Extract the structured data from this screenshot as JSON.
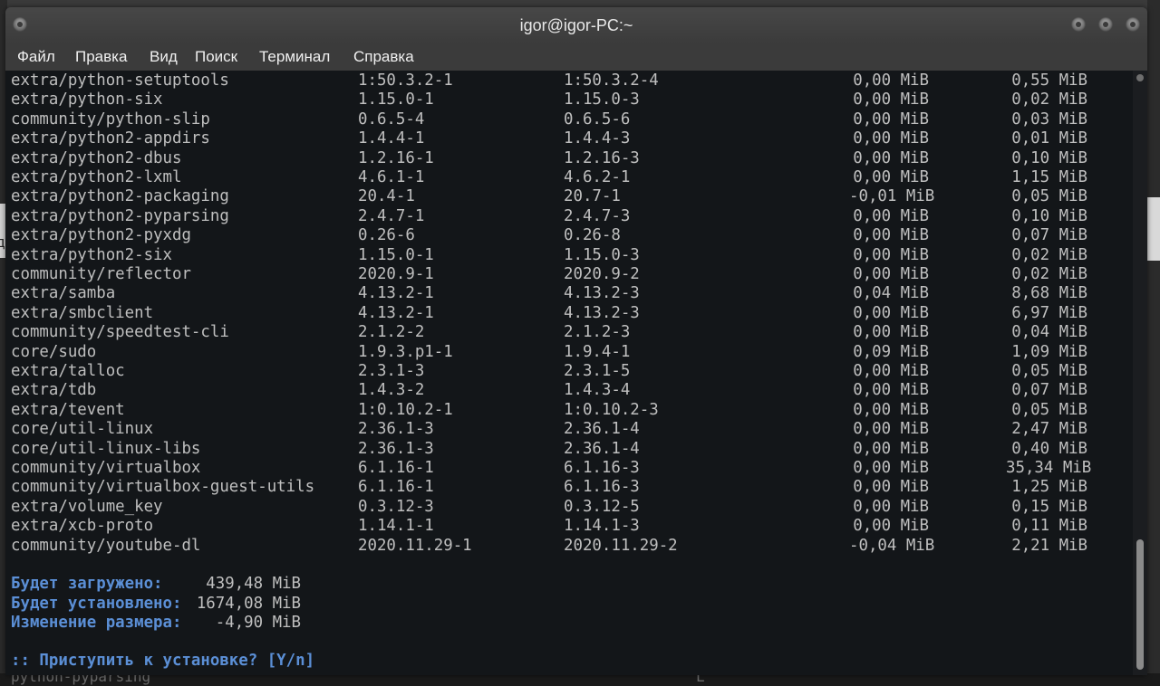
{
  "window": {
    "title": "igor@igor-PC:~"
  },
  "menu": [
    "Файл",
    "Правка",
    "Вид",
    "Поиск",
    "Терминал",
    "Справка"
  ],
  "background": {
    "bottom_text": "python-pyparsing",
    "bottom_tick": "L",
    "left_edge_text": "д"
  },
  "packages": [
    {
      "name": "extra/python-setuptools",
      "old": "1:50.3.2-1",
      "new": "1:50.3.2-4",
      "net": "0,00 MiB",
      "dl": "0,55 MiB"
    },
    {
      "name": "extra/python-six",
      "old": "1.15.0-1",
      "new": "1.15.0-3",
      "net": "0,00 MiB",
      "dl": "0,02 MiB"
    },
    {
      "name": "community/python-slip",
      "old": "0.6.5-4",
      "new": "0.6.5-6",
      "net": "0,00 MiB",
      "dl": "0,03 MiB"
    },
    {
      "name": "extra/python2-appdirs",
      "old": "1.4.4-1",
      "new": "1.4.4-3",
      "net": "0,00 MiB",
      "dl": "0,01 MiB"
    },
    {
      "name": "extra/python2-dbus",
      "old": "1.2.16-1",
      "new": "1.2.16-3",
      "net": "0,00 MiB",
      "dl": "0,10 MiB"
    },
    {
      "name": "extra/python2-lxml",
      "old": "4.6.1-1",
      "new": "4.6.2-1",
      "net": "0,00 MiB",
      "dl": "1,15 MiB"
    },
    {
      "name": "extra/python2-packaging",
      "old": "20.4-1",
      "new": "20.7-1",
      "net": "-0,01 MiB",
      "dl": "0,05 MiB"
    },
    {
      "name": "extra/python2-pyparsing",
      "old": "2.4.7-1",
      "new": "2.4.7-3",
      "net": "0,00 MiB",
      "dl": "0,10 MiB"
    },
    {
      "name": "extra/python2-pyxdg",
      "old": "0.26-6",
      "new": "0.26-8",
      "net": "0,00 MiB",
      "dl": "0,07 MiB"
    },
    {
      "name": "extra/python2-six",
      "old": "1.15.0-1",
      "new": "1.15.0-3",
      "net": "0,00 MiB",
      "dl": "0,02 MiB"
    },
    {
      "name": "community/reflector",
      "old": "2020.9-1",
      "new": "2020.9-2",
      "net": "0,00 MiB",
      "dl": "0,02 MiB"
    },
    {
      "name": "extra/samba",
      "old": "4.13.2-1",
      "new": "4.13.2-3",
      "net": "0,04 MiB",
      "dl": "8,68 MiB"
    },
    {
      "name": "extra/smbclient",
      "old": "4.13.2-1",
      "new": "4.13.2-3",
      "net": "0,00 MiB",
      "dl": "6,97 MiB"
    },
    {
      "name": "community/speedtest-cli",
      "old": "2.1.2-2",
      "new": "2.1.2-3",
      "net": "0,00 MiB",
      "dl": "0,04 MiB"
    },
    {
      "name": "core/sudo",
      "old": "1.9.3.p1-1",
      "new": "1.9.4-1",
      "net": "0,09 MiB",
      "dl": "1,09 MiB"
    },
    {
      "name": "extra/talloc",
      "old": "2.3.1-3",
      "new": "2.3.1-5",
      "net": "0,00 MiB",
      "dl": "0,05 MiB"
    },
    {
      "name": "extra/tdb",
      "old": "1.4.3-2",
      "new": "1.4.3-4",
      "net": "0,00 MiB",
      "dl": "0,07 MiB"
    },
    {
      "name": "extra/tevent",
      "old": "1:0.10.2-1",
      "new": "1:0.10.2-3",
      "net": "0,00 MiB",
      "dl": "0,05 MiB"
    },
    {
      "name": "core/util-linux",
      "old": "2.36.1-3",
      "new": "2.36.1-4",
      "net": "0,00 MiB",
      "dl": "2,47 MiB"
    },
    {
      "name": "core/util-linux-libs",
      "old": "2.36.1-3",
      "new": "2.36.1-4",
      "net": "0,00 MiB",
      "dl": "0,40 MiB"
    },
    {
      "name": "community/virtualbox",
      "old": "6.1.16-1",
      "new": "6.1.16-3",
      "net": "0,00 MiB",
      "dl": "35,34 MiB"
    },
    {
      "name": "community/virtualbox-guest-utils",
      "old": "6.1.16-1",
      "new": "6.1.16-3",
      "net": "0,00 MiB",
      "dl": "1,25 MiB"
    },
    {
      "name": "extra/volume_key",
      "old": "0.3.12-3",
      "new": "0.3.12-5",
      "net": "0,00 MiB",
      "dl": "0,15 MiB"
    },
    {
      "name": "extra/xcb-proto",
      "old": "1.14.1-1",
      "new": "1.14.1-3",
      "net": "0,00 MiB",
      "dl": "0,11 MiB"
    },
    {
      "name": "community/youtube-dl",
      "old": "2020.11.29-1",
      "new": "2020.11.29-2",
      "net": "-0,04 MiB",
      "dl": "2,21 MiB"
    }
  ],
  "summary": [
    {
      "label": "Будет загружено:",
      "value": "439,48 MiB"
    },
    {
      "label": "Будет установлено:",
      "value": "1674,08 MiB"
    },
    {
      "label": "Изменение размера:",
      "value": "-4,90 MiB"
    }
  ],
  "prompt": ":: Приступить к установке? [Y/n]",
  "colors": {
    "terminal_bg": "#131619",
    "terminal_fg": "#bfbfbf",
    "accent_blue": "#5b8fd6"
  }
}
